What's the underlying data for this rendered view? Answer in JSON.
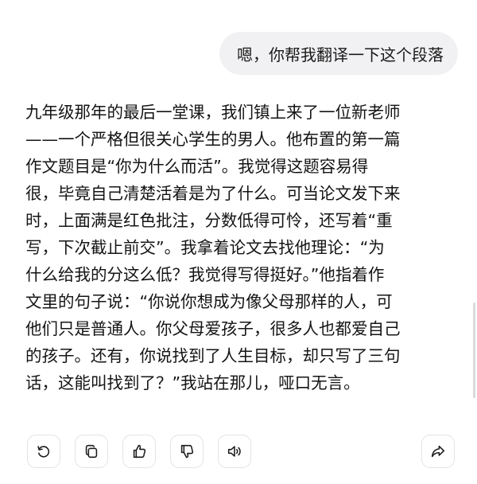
{
  "user_message": {
    "text": "嗯，你帮我翻译一下这个段落"
  },
  "assistant_message": {
    "lines": [
      "九年级那年的最后一堂课，我们镇上来了一位新老师",
      "——一个严格但很关心学生的男人。他布置的第一篇",
      "作文题目是“你为什么而活”。我觉得这题容易得",
      "很，毕竟自己清楚活着是为了什么。可当论文发下来",
      "时，上面满是红色批注，分数低得可怜，还写着“重",
      "写，下次截止前交”。我拿着论文去找他理论：“为",
      "什么给我的分这么低？我觉得写得挺好。”他指着作",
      "文里的句子说：“你说你想成为像父母那样的人，可",
      "他们只是普通人。你父母爱孩子，很多人也都爱自己",
      "的孩子。还有，你说找到了人生目标，却只写了三句",
      "话，这能叫找到了？”我站在那儿，哑口无言。"
    ]
  },
  "actions": [
    {
      "icon": "regenerate-icon"
    },
    {
      "icon": "copy-icon"
    },
    {
      "icon": "thumbs-up-icon"
    },
    {
      "icon": "thumbs-down-icon"
    },
    {
      "icon": "speaker-icon"
    },
    {
      "icon": "share-icon"
    }
  ]
}
